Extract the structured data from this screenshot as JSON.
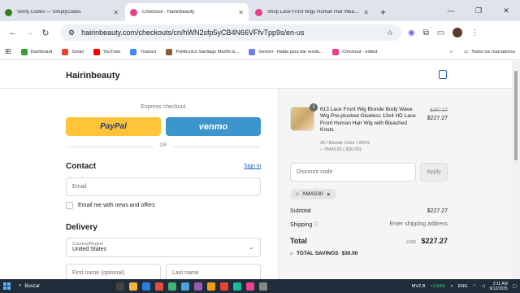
{
  "browser": {
    "tabs": [
      {
        "title": "Verify Codes — SimplyCodes",
        "active": false,
        "color": "#3a7d1f"
      },
      {
        "title": "Checkout - Hairinbeauty",
        "active": true,
        "color": "#e8418b"
      },
      {
        "title": "Shop Lace Front Wigs Human Hair Weave Bundles",
        "active": false,
        "color": "#e8418b"
      }
    ],
    "url": "hairinbeauty.com/checkouts/cn/hWN2sfp5yCB4N66VFfvTpp9s/en-us",
    "bookmarks": [
      {
        "label": "Dashboard",
        "color": "#3a9d2e"
      },
      {
        "label": "Gmail",
        "color": "#ea4335"
      },
      {
        "label": "YouTube",
        "color": "#ff0000"
      },
      {
        "label": "Traducir",
        "color": "#4285f4"
      },
      {
        "label": "Politécnico Santiago Mariño E...",
        "color": "#8c5a3c"
      },
      {
        "label": "Gemini - Habla para dar renda...",
        "color": "#6f7ef5"
      },
      {
        "label": "Checkout - edited",
        "color": "#e8418b"
      }
    ],
    "all_bookmarks": "Todos los marcadores"
  },
  "store": {
    "brand": "Hairinbeauty"
  },
  "checkout": {
    "express_label": "Express checkout",
    "paypal_label": "PayPal",
    "venmo_label": "venmo",
    "or_label": "OR",
    "contact_title": "Contact",
    "signin_label": "Sign in",
    "email_placeholder": "Email",
    "newsletter_label": "Email me with news and offers",
    "delivery_title": "Delivery",
    "country_label": "Country/Region",
    "country_value": "United States",
    "first_name_placeholder": "First name (optional)",
    "last_name_placeholder": "Last name"
  },
  "summary": {
    "product": {
      "quantity": "1",
      "name": "613 Lace Front Wig Blonde Body Wave Wig Pre-plucked Glueless 13x4 HD Lace Front Human Hair Wig with Bleached Knots",
      "variant": "26 / Blonde Color / 200%",
      "discount_line": "XMAS30 (-$30.00)",
      "original_price": "$257.27",
      "price": "$227.27"
    },
    "discount_placeholder": "Discount code",
    "apply_label": "Apply",
    "applied_code": "XMAS30",
    "subtotal_label": "Subtotal",
    "subtotal_value": "$227.27",
    "shipping_label": "Shipping",
    "shipping_value": "Enter shipping address",
    "total_label": "Total",
    "currency": "USD",
    "total_value": "$227.27",
    "savings_label": "TOTAL SAVINGS",
    "savings_value": "$30.00"
  },
  "taskbar": {
    "search_label": "Buscar",
    "ticker_name": "MVZ.B",
    "ticker_change": "+3.54%",
    "lang": "ENG",
    "time": "2:11 AM",
    "date": "9/12/2025"
  }
}
